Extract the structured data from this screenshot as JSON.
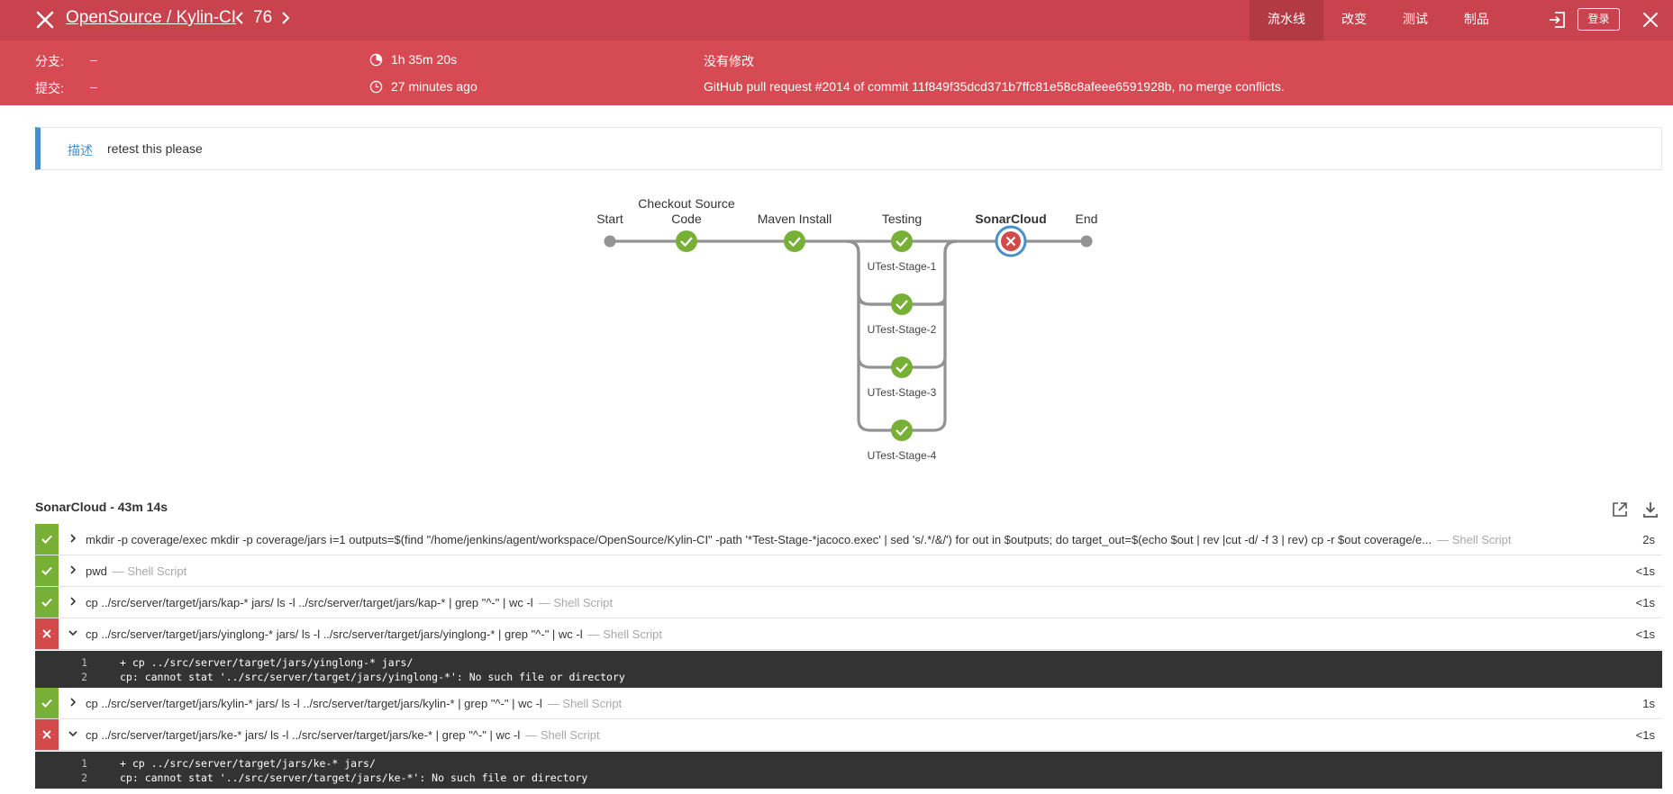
{
  "header": {
    "breadcrumb": "OpenSource / Kylin-CI",
    "run_number": "76",
    "tabs": [
      {
        "label": "流水线",
        "active": true
      },
      {
        "label": "改变",
        "active": false
      },
      {
        "label": "测试",
        "active": false
      },
      {
        "label": "制品",
        "active": false
      }
    ],
    "login_label": "登录"
  },
  "info": {
    "branch_label": "分支:",
    "branch_value": "–",
    "commit_label": "提交:",
    "commit_value": "–",
    "duration": "1h 35m 20s",
    "started": "27 minutes ago",
    "changes": "没有修改",
    "cause": "GitHub pull request #2014 of commit 11f849f35dcd371b7ffc81e58c8afeee6591928b, no merge conflicts."
  },
  "description": {
    "label": "描述",
    "text": "retest this please"
  },
  "pipeline": {
    "stages": [
      {
        "name": "Start",
        "status": "start"
      },
      {
        "name": "Checkout Source Code",
        "status": "success"
      },
      {
        "name": "Maven Install",
        "status": "success"
      },
      {
        "name": "Testing",
        "status": "success"
      },
      {
        "name": "SonarCloud",
        "status": "failure",
        "selected": true
      },
      {
        "name": "End",
        "status": "end"
      }
    ],
    "parallel": [
      "UTest-Stage-1",
      "UTest-Stage-2",
      "UTest-Stage-3",
      "UTest-Stage-4"
    ]
  },
  "steps_panel": {
    "title": "SonarCloud - 43m 14s",
    "steps": [
      {
        "status": "success",
        "expanded": false,
        "command": "mkdir -p coverage/exec mkdir -p coverage/jars i=1 outputs=$(find \"/home/jenkins/agent/workspace/OpenSource/Kylin-CI\" -path '*Test-Stage-*jacoco.exec' | sed 's/.*/&/') for out in $outputs; do target_out=$(echo $out | rev |cut -d/ -f 3 | rev) cp -r $out coverage/e...",
        "type": "— Shell Script",
        "duration": "2s"
      },
      {
        "status": "success",
        "expanded": false,
        "command": "pwd",
        "type": "— Shell Script",
        "duration": "<1s"
      },
      {
        "status": "success",
        "expanded": false,
        "command": "cp ../src/server/target/jars/kap-* jars/ ls -l ../src/server/target/jars/kap-* | grep \"^-\" | wc -l",
        "type": "— Shell Script",
        "duration": "<1s"
      },
      {
        "status": "failure",
        "expanded": true,
        "command": "cp ../src/server/target/jars/yinglong-* jars/ ls -l ../src/server/target/jars/yinglong-* | grep \"^-\" | wc -l",
        "type": "— Shell Script",
        "duration": "<1s",
        "log": [
          {
            "n": "1",
            "text": "+ cp ../src/server/target/jars/yinglong-* jars/"
          },
          {
            "n": "2",
            "text": "cp: cannot stat '../src/server/target/jars/yinglong-*': No such file or directory"
          }
        ]
      },
      {
        "status": "success",
        "expanded": false,
        "command": "cp ../src/server/target/jars/kylin-* jars/ ls -l ../src/server/target/jars/kylin-* | grep \"^-\" | wc -l",
        "type": "— Shell Script",
        "duration": "1s"
      },
      {
        "status": "failure",
        "expanded": true,
        "command": "cp ../src/server/target/jars/ke-* jars/ ls -l ../src/server/target/jars/ke-* | grep \"^-\" | wc -l",
        "type": "— Shell Script",
        "duration": "<1s",
        "log": [
          {
            "n": "1",
            "text": "+ cp ../src/server/target/jars/ke-* jars/"
          },
          {
            "n": "2",
            "text": "cp: cannot stat '../src/server/target/jars/ke-*': No such file or directory"
          }
        ]
      }
    ]
  },
  "colors": {
    "header_bg": "#c8434d",
    "info_bg": "#d64a53",
    "success": "#78b037",
    "failure": "#d24a4a",
    "accent": "#4a90c8"
  }
}
